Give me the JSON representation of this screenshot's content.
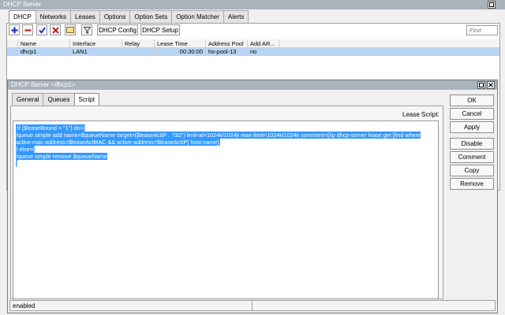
{
  "main_window": {
    "title": "DHCP Server",
    "tabs": [
      "DHCP",
      "Networks",
      "Leases",
      "Options",
      "Option Sets",
      "Option Matcher",
      "Alerts"
    ],
    "active_tab": "DHCP",
    "toolbar": {
      "icons": [
        "add-icon",
        "remove-icon",
        "enable-check-icon",
        "disable-x-icon",
        "comment-icon",
        "filter-icon"
      ],
      "dhcp_config": "DHCP Config",
      "dhcp_setup": "DHCP Setup",
      "find_placeholder": "Find"
    },
    "columns": [
      "Name",
      "Interface",
      "Relay",
      "Lease Time",
      "Address Pool",
      "Add AR..."
    ],
    "rows": [
      {
        "name": "dhcp1",
        "interface": "LAN1",
        "relay": "",
        "lease_time": "00:30:00",
        "address_pool": "hs-pool-13",
        "add_arp": "no"
      }
    ]
  },
  "dialog": {
    "title": "DHCP Server <dhcp1>",
    "tabs": [
      "General",
      "Queues",
      "Script"
    ],
    "active_tab": "Script",
    "field_label": "Lease Script:",
    "script_lines": [
      ":if ($leaseBound = \"1\") do={",
      "   /queue simple add name=$queueName target=($leaseActIP . \"/32\") limit-at=1024k/1024k max-limit=1024k/1024k comment=[/ip dhcp-server lease get [find where",
      "active-mac-address=$leaseActMAC && active-address=$leaseActIP] host-name];",
      "} else={",
      "   /queue simple remove $queueName",
      "}"
    ],
    "buttons": {
      "ok": "OK",
      "cancel": "Cancel",
      "apply": "Apply",
      "disable": "Disable",
      "comment": "Comment",
      "copy": "Copy",
      "remove": "Remove"
    },
    "status": "enabled"
  }
}
